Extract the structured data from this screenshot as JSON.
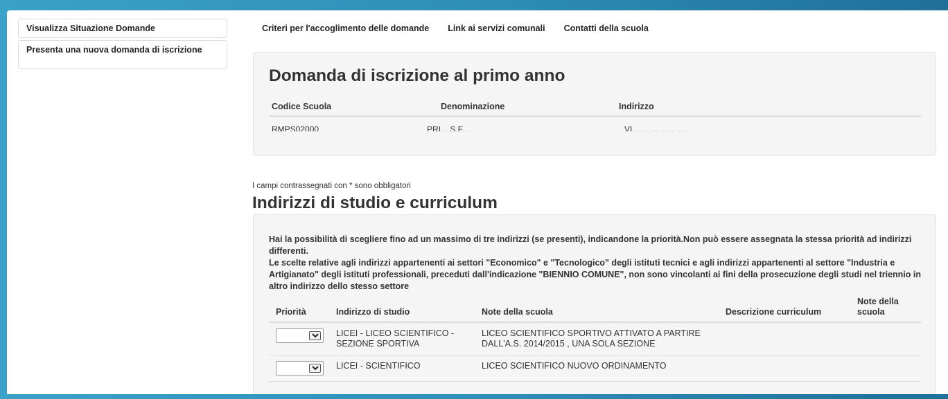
{
  "sidebar": {
    "items": [
      {
        "label": "Visualizza Situazione Domande"
      },
      {
        "label": "Presenta una nuova domanda di iscrizione"
      }
    ]
  },
  "topnav": {
    "links": [
      {
        "label": "Criteri per l'accoglimento delle domande"
      },
      {
        "label": "Link ai servizi comunali"
      },
      {
        "label": "Contatti della scuola"
      }
    ]
  },
  "school": {
    "title": "Domanda di iscrizione al primo anno",
    "columns": [
      "Codice Scuola",
      "Denominazione",
      "Indirizzo"
    ],
    "values": [
      "RMPS02000",
      "PRI... S.F... ",
      "VI... ... ... ... ... ..."
    ]
  },
  "form": {
    "required_note": "I campi contrassegnati con * sono obbligatori",
    "section_title": "Indirizzi di studio e curriculum",
    "intro_1": "Hai la possibilità di scegliere fino ad un massimo di tre indirizzi (se presenti), indicandone la priorità.Non può essere assegnata la stessa priorità ad indirizzi differenti.",
    "intro_2": "Le scelte relative agli indirizzi appartenenti ai settori \"Economico\" e \"Tecnologico\" degli istituti tecnici e agli indirizzi appartenenti al settore \"Industria e Artigianato\" degli istituti professionali, preceduti dall'indicazione \"BIENNIO COMUNE\", non sono vincolanti ai fini della prosecuzione degli studi nel triennio in altro indirizzo dello stesso settore",
    "table": {
      "headers": [
        "Priorità",
        "Indirizzo di studio",
        "Note della scuola",
        "Descrizione curriculum",
        "Note della scuola"
      ],
      "rows": [
        {
          "priority": "",
          "indirizzo": "LICEI - LICEO SCIENTIFICO - SEZIONE SPORTIVA",
          "note": "LICEO SCIENTIFICO SPORTIVO ATTIVATO A PARTIRE DALL'A.S. 2014/2015 , UNA SOLA SEZIONE",
          "descrizione": "",
          "note2": ""
        },
        {
          "priority": "",
          "indirizzo": "LICEI - SCIENTIFICO",
          "note": "LICEO SCIENTIFICO NUOVO ORDINAMENTO",
          "descrizione": "",
          "note2": ""
        }
      ]
    }
  }
}
